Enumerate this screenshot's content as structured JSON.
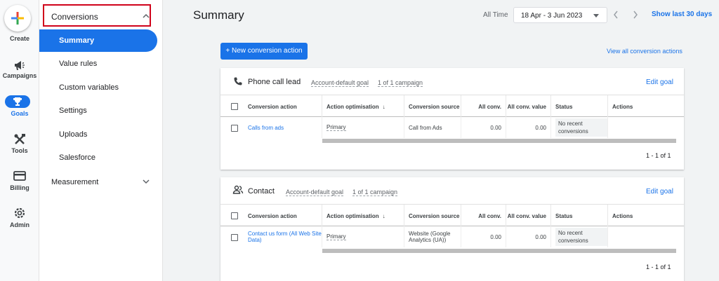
{
  "rail": {
    "create_label": "Create",
    "items": [
      {
        "label": "Campaigns",
        "icon": "megaphone-icon"
      },
      {
        "label": "Goals",
        "icon": "trophy-icon"
      },
      {
        "label": "Tools",
        "icon": "tools-icon"
      },
      {
        "label": "Billing",
        "icon": "credit-card-icon"
      },
      {
        "label": "Admin",
        "icon": "gear-icon"
      }
    ]
  },
  "subnav": {
    "section_label": "Conversions",
    "items": [
      "Summary",
      "Value rules",
      "Custom variables",
      "Settings",
      "Uploads",
      "Salesforce"
    ],
    "active_index": 0,
    "measurement_label": "Measurement"
  },
  "header": {
    "title": "Summary",
    "range_label": "All Time",
    "date_range": "18 Apr - 3 Jun 2023",
    "show_last": "Show last 30 days"
  },
  "actions": {
    "new_button": "+ New conversion action",
    "view_all": "View all conversion actions"
  },
  "table_columns": [
    "Conversion action",
    "Action optimisation",
    "Conversion source",
    "All conv.",
    "All conv. value",
    "Status",
    "Actions"
  ],
  "goals": [
    {
      "title": "Phone call lead",
      "account_default": "Account-default goal",
      "campaigns": "1 of 1 campaign",
      "edit_label": "Edit goal",
      "row": {
        "action": "Calls from ads",
        "optimisation": "Primary",
        "source": "Call from Ads",
        "all_conv": "0.00",
        "all_conv_value": "0.00",
        "status": "No recent conversions"
      },
      "pagination": "1 - 1 of 1"
    },
    {
      "title": "Contact",
      "account_default": "Account-default goal",
      "campaigns": "1 of 1 campaign",
      "edit_label": "Edit goal",
      "row": {
        "action": "Contact us form (All Web Site Data)",
        "optimisation": "Primary",
        "source": "Website (Google Analytics (UA))",
        "all_conv": "0.00",
        "all_conv_value": "0.00",
        "status": "No recent conversions"
      },
      "pagination": "1 - 1 of 1"
    }
  ],
  "colors": {
    "accent": "#1a73e8",
    "highlight_box": "#d0021b"
  }
}
